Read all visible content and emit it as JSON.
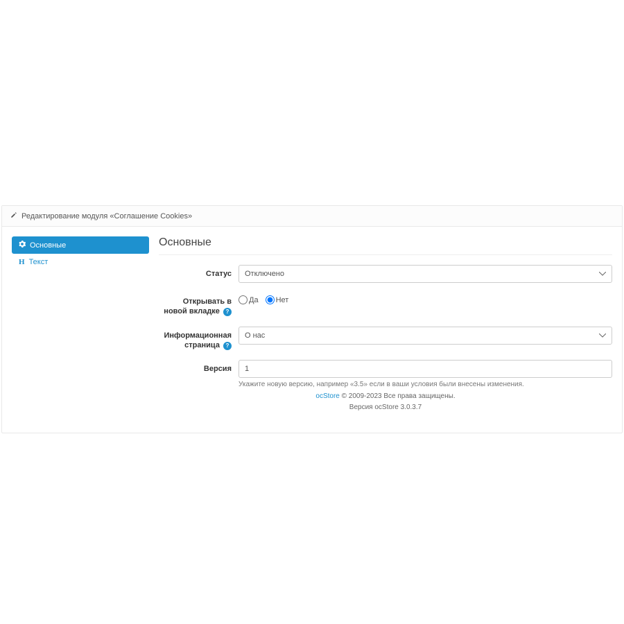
{
  "panel": {
    "heading": "Редактирование модуля «Соглашение Cookies»"
  },
  "nav": {
    "tab_main": "Основные",
    "tab_text": "Текст"
  },
  "form": {
    "legend": "Основные",
    "status_label": "Статус",
    "status_value": "Отключено",
    "newtab_label": "Открывать в новой вкладке",
    "yes": "Да",
    "no": "Нет",
    "infopage_label": "Информационная страница",
    "infopage_value": "О нас",
    "version_label": "Версия",
    "version_value": "1",
    "version_help": "Укажите новую версию, например «3.5» если в ваши условия были внесены изменения."
  },
  "footer": {
    "brand": "ocStore",
    "copyright": " © 2009-2023 Все права защищены.",
    "version": "Версия ocStore 3.0.3.7"
  }
}
